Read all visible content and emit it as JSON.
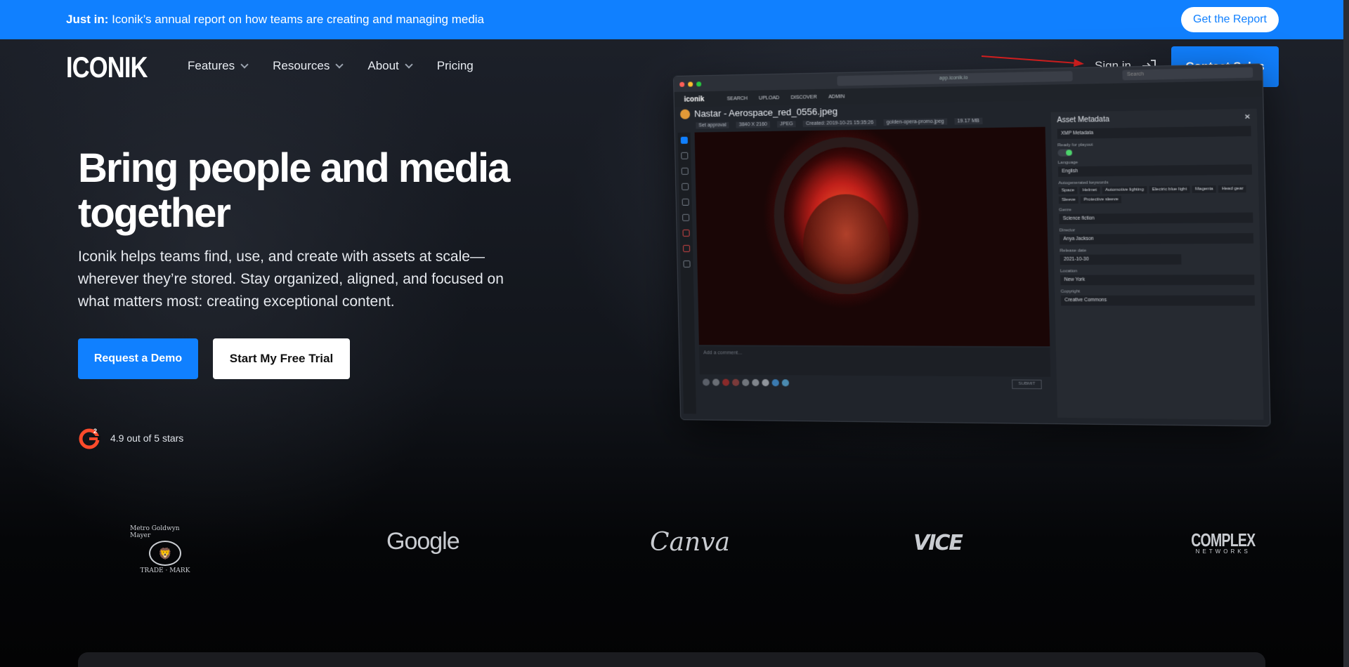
{
  "announcement": {
    "lead": "Just in:",
    "text": " Iconik’s annual report on how teams are creating and managing media",
    "button": "Get the Report"
  },
  "brand": {
    "logo": "ICONIK"
  },
  "nav": {
    "items": [
      {
        "label": "Features",
        "dropdown": true
      },
      {
        "label": "Resources",
        "dropdown": true
      },
      {
        "label": "About",
        "dropdown": true
      },
      {
        "label": "Pricing",
        "dropdown": false
      }
    ],
    "sign_in": "Sign in",
    "contact": "Contact Sales"
  },
  "hero": {
    "headline": "Bring people and media together",
    "subtext": "Iconik helps teams find, use, and create with assets at scale—wherever they’re stored. Stay organized, aligned, and focused on what matters most: creating exceptional content.",
    "primary_cta": "Request a Demo",
    "secondary_cta": "Start My Free Trial",
    "rating_text": "4.9 out of 5 stars",
    "rating_badge": "G2"
  },
  "mockup": {
    "url": "app.iconik.io",
    "search_placeholder": "Search",
    "brand": "iconik",
    "nav": [
      "SEARCH",
      "UPLOAD",
      "DISCOVER",
      "ADMIN"
    ],
    "asset_title": "Nastar - Aerospace_red_0556.jpeg",
    "meta": [
      "Set approval",
      "3840 X 2160",
      "JPEG",
      "Created: 2019-10-21 15:35:26",
      "golden-opera-promo.jpeg",
      "19.17 MB"
    ],
    "comment_placeholder": "Add a comment...",
    "submit": "SUBMIT",
    "panel": {
      "title": "Asset Metadata",
      "view": "XMP Metadata",
      "ready_label": "Ready for playout",
      "language_label": "Language",
      "language": "English",
      "keywords_label": "Autogenerated keywords",
      "keywords": [
        "Space",
        "Helmet",
        "Automotive lighting",
        "Electric blue light",
        "Magenta",
        "Head gear",
        "Sleeve",
        "Protective sleeve"
      ],
      "genre_label": "Genre",
      "genre": "Science fiction",
      "director_label": "Director",
      "director": "Anya Jackson",
      "release_label": "Release date",
      "release": "2021-10-30",
      "location_label": "Location",
      "location": "New York",
      "copyright_label": "Copyright",
      "copyright": "Creative Commons"
    }
  },
  "logos": {
    "mgm_top": "Metro Goldwyn Mayer",
    "mgm_left": "TRADE",
    "mgm_right": "MARK",
    "google": "Google",
    "canva": "Canva",
    "vice": "VICE",
    "complex": "COMPLEX",
    "complex_sub": "NETWORKS"
  },
  "colors": {
    "accent": "#1080ff",
    "annotation_arrow": "#e02020"
  }
}
